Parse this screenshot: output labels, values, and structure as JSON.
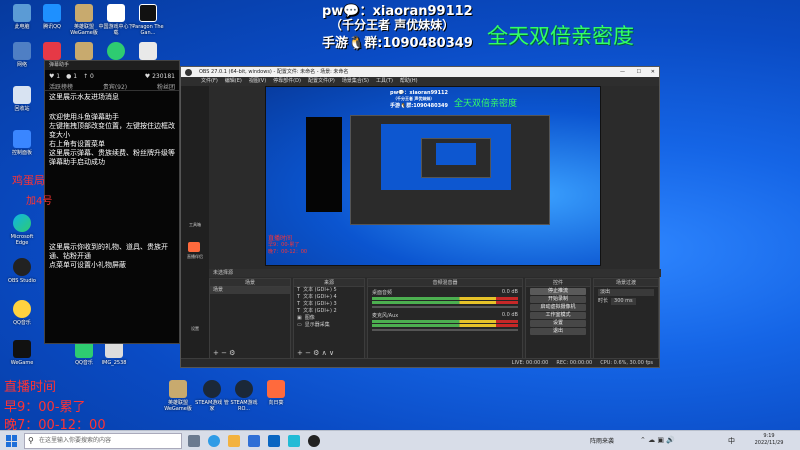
{
  "desktop": {
    "icons_col1": [
      "此电脑",
      "网络",
      "回收站",
      "控制面板",
      "Microsoft Edge",
      "OBS Studio",
      "QQ音乐",
      "WeGame",
      "英雄联盟 WeGame版"
    ],
    "icons_row1": [
      "腾讯QQ",
      "英雄联盟WeGame版",
      "中国游戏中心下载",
      "网易云音乐",
      "Paragon The Gan..."
    ],
    "icons_col2": [
      "QQ音乐",
      "IMG_2538"
    ],
    "bottom_icons": [
      "英雄联盟 WeGame版",
      "STEAM游戏 管家",
      "STEAM游戏 RO...",
      "向日葵"
    ],
    "icon_colors": [
      "#3a86ff",
      "#d1b25a",
      "#ffffff",
      "#2ecc71",
      "#e63946",
      "#222222",
      "#f4a261",
      "#ff5a5a"
    ]
  },
  "overlay": {
    "line1": "pw💬：xiaoran99112",
    "line2": "（千分王者 声优妹妹）",
    "line3": "手游🐧群:1090480349",
    "slogan": "全天双倍亲密度",
    "cursor_left": "鸡蛋局",
    "cursor_left2": "加4号",
    "schedule_title": "直播时间",
    "schedule_l1": "早9：00-累了",
    "schedule_l2": "晚7：00-12：00",
    "colors": {
      "white": "#ffffff",
      "cyan": "#45e0ff",
      "green": "#33ff66",
      "red": "#ff3333"
    }
  },
  "danmaku": {
    "header": "弹幕助手",
    "stats": {
      "likes": "♥ 1",
      "gift": "● 1",
      "lock": "↑ 0",
      "fans": "♥ 230181"
    },
    "tabs": [
      "活跃榜榜",
      "贵宾(92)",
      "粉丝团"
    ],
    "msg1": "这里展示水友进场消息",
    "msg2": "欢迎使用斗鱼弹幕助手\n左键拖拽顶部改变位置，左键按住边框改变大小\n右上角有设置菜单\n这里展示弹幕、贵族续费、粉丝牌升级等\n弹幕助手启动成功",
    "msg3": "这里展示你收到的礼物、道具、贵族开通、钻粉开通\n点菜单可设置小礼物屏蔽"
  },
  "obs": {
    "title": "OBS 27.0.1 (64-bit, windows) - 配置文件: 未命名 - 场景: 未命名",
    "menu": [
      "文件(F)",
      "编辑(E)",
      "视图(V)",
      "停靠部件(D)",
      "配置文件(P)",
      "场景集合(S)",
      "工具(T)",
      "帮助(H)"
    ],
    "sidebar": [
      "工具箱",
      "直播伴侣",
      "设置"
    ],
    "scenes_title": "场景",
    "scenes": [
      "场景"
    ],
    "sources_title": "来源",
    "sources": [
      "文本 (GDI+) 5",
      "文本 (GDI+) 4",
      "文本 (GDI+) 3",
      "文本 (GDI+) 2",
      "图像",
      "显示器采集"
    ],
    "mixer_title": "音频混音器",
    "mixer": [
      {
        "name": "桌面音频",
        "db": "0.0 dB"
      },
      {
        "name": "麦克风/Aux",
        "db": "0.0 dB"
      }
    ],
    "transition_title": "场景过渡",
    "transition": {
      "type": "淡出",
      "label": "时长",
      "duration": "300 ms"
    },
    "controls_title": "控件",
    "controls": [
      "停止推流",
      "开始录制",
      "启动虚拟摄像机",
      "工作室模式",
      "设置",
      "退出"
    ],
    "status": {
      "live": "LIVE: 00:00:00",
      "rec": "REC: 00:00:00",
      "cpu": "CPU: 0.6%, 30.00 fps"
    },
    "panel_header": "未选择源"
  },
  "taskbar": {
    "search_placeholder": "在这里输入你要搜索的内容",
    "weather": "阵雨来袭",
    "time": "9:19",
    "date": "2022/11/29",
    "ime": "中"
  }
}
